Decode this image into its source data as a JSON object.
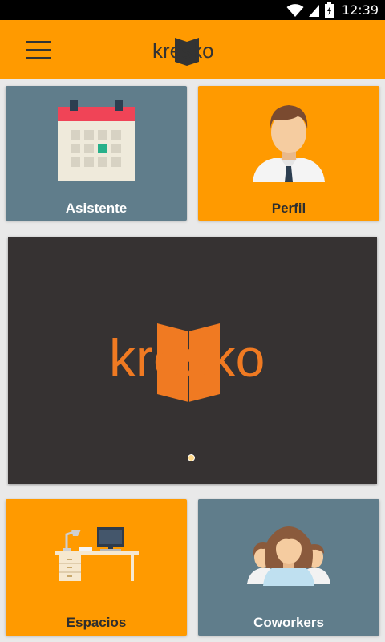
{
  "status_bar": {
    "time": "12:39",
    "icons": [
      "wifi-icon",
      "signal-icon",
      "battery-icon"
    ]
  },
  "app_bar": {
    "logo_text": "kresko",
    "menu_icon": "hamburger-menu-icon"
  },
  "tiles": {
    "asistente": {
      "label": "Asistente",
      "icon": "calendar-icon",
      "color": "#607d8b"
    },
    "perfil": {
      "label": "Perfil",
      "icon": "profile-person-icon",
      "color": "#ff9a00"
    },
    "espacios": {
      "label": "Espacios",
      "icon": "desk-workspace-icon",
      "color": "#ff9a00"
    },
    "coworkers": {
      "label": "Coworkers",
      "icon": "group-people-icon",
      "color": "#607d8b"
    }
  },
  "banner": {
    "logo_text": "kresko",
    "slide_count": 1,
    "active_slide": 1
  },
  "colors": {
    "brand_orange": "#ff9a00",
    "slate": "#607d8b",
    "banner_bg": "#363232",
    "logo_orange": "#f07a22"
  }
}
